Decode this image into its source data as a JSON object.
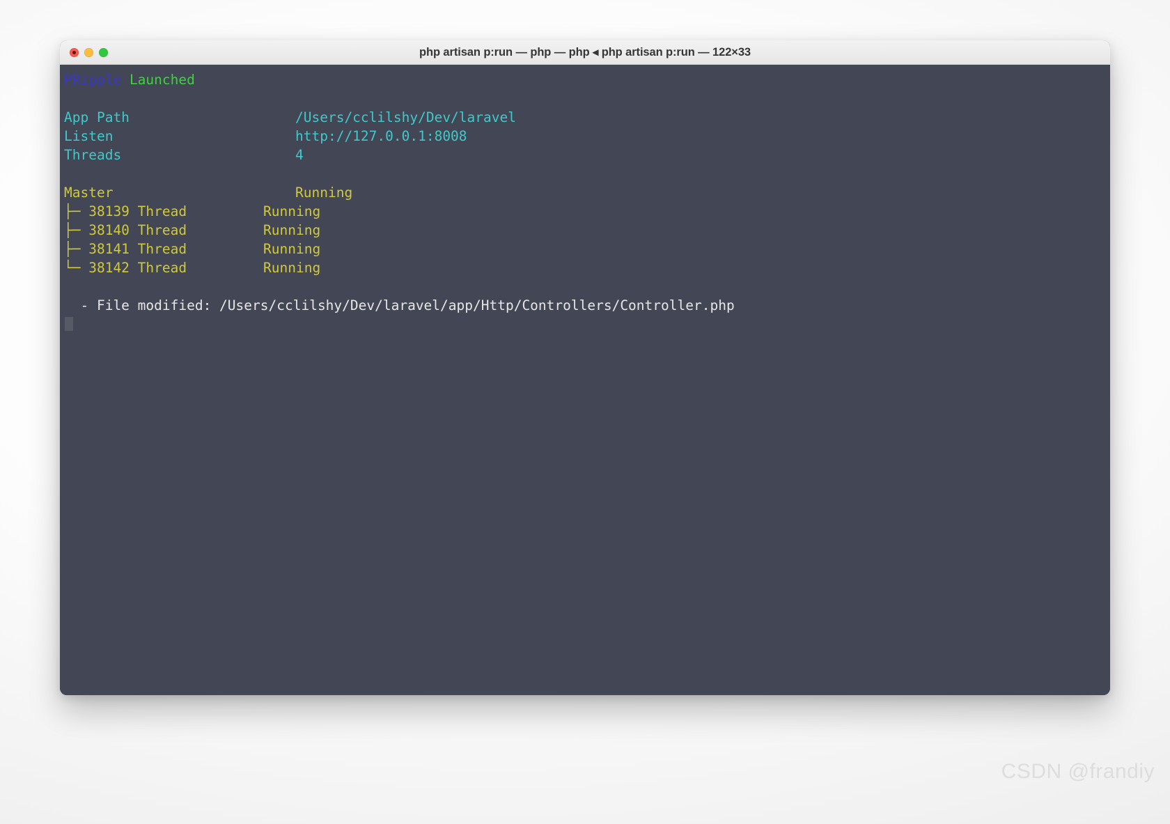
{
  "window": {
    "title": "php artisan p:run — php — php ◂ php artisan p:run — 122×33",
    "traffic_lights": {
      "close_label": "close",
      "minimize_label": "minimize",
      "maximize_label": "maximize"
    }
  },
  "terminal": {
    "banner": {
      "app": "PRipple",
      "status": "Launched"
    },
    "info_rows": [
      {
        "label": "App Path",
        "value": "/Users/cclilshy/Dev/laravel"
      },
      {
        "label": "Listen",
        "value": "http://127.0.0.1:8008"
      },
      {
        "label": "Threads",
        "value": "4"
      }
    ],
    "master": {
      "label": "Master",
      "status": "Running"
    },
    "threads": [
      {
        "branch": "├─",
        "pid": "38139",
        "kind": "Thread",
        "status": "Running"
      },
      {
        "branch": "├─",
        "pid": "38140",
        "kind": "Thread",
        "status": "Running"
      },
      {
        "branch": "├─",
        "pid": "38141",
        "kind": "Thread",
        "status": "Running"
      },
      {
        "branch": "└─",
        "pid": "38142",
        "kind": "Thread",
        "status": "Running"
      }
    ],
    "log_lines": [
      "  - File modified: /Users/cclilshy/Dev/laravel/app/Http/Controllers/Controller.php"
    ],
    "prompt_cursor": ""
  },
  "watermark": "CSDN @frandiy",
  "colors": {
    "terminal_bg": "#434755",
    "titlebar_bg": "#ececec",
    "blue": "#3b36c9",
    "green": "#3ad43a",
    "cyan": "#3fc9c9",
    "yellow": "#cfc93b",
    "white": "#e6e6e6",
    "cursor": "#565a66"
  }
}
